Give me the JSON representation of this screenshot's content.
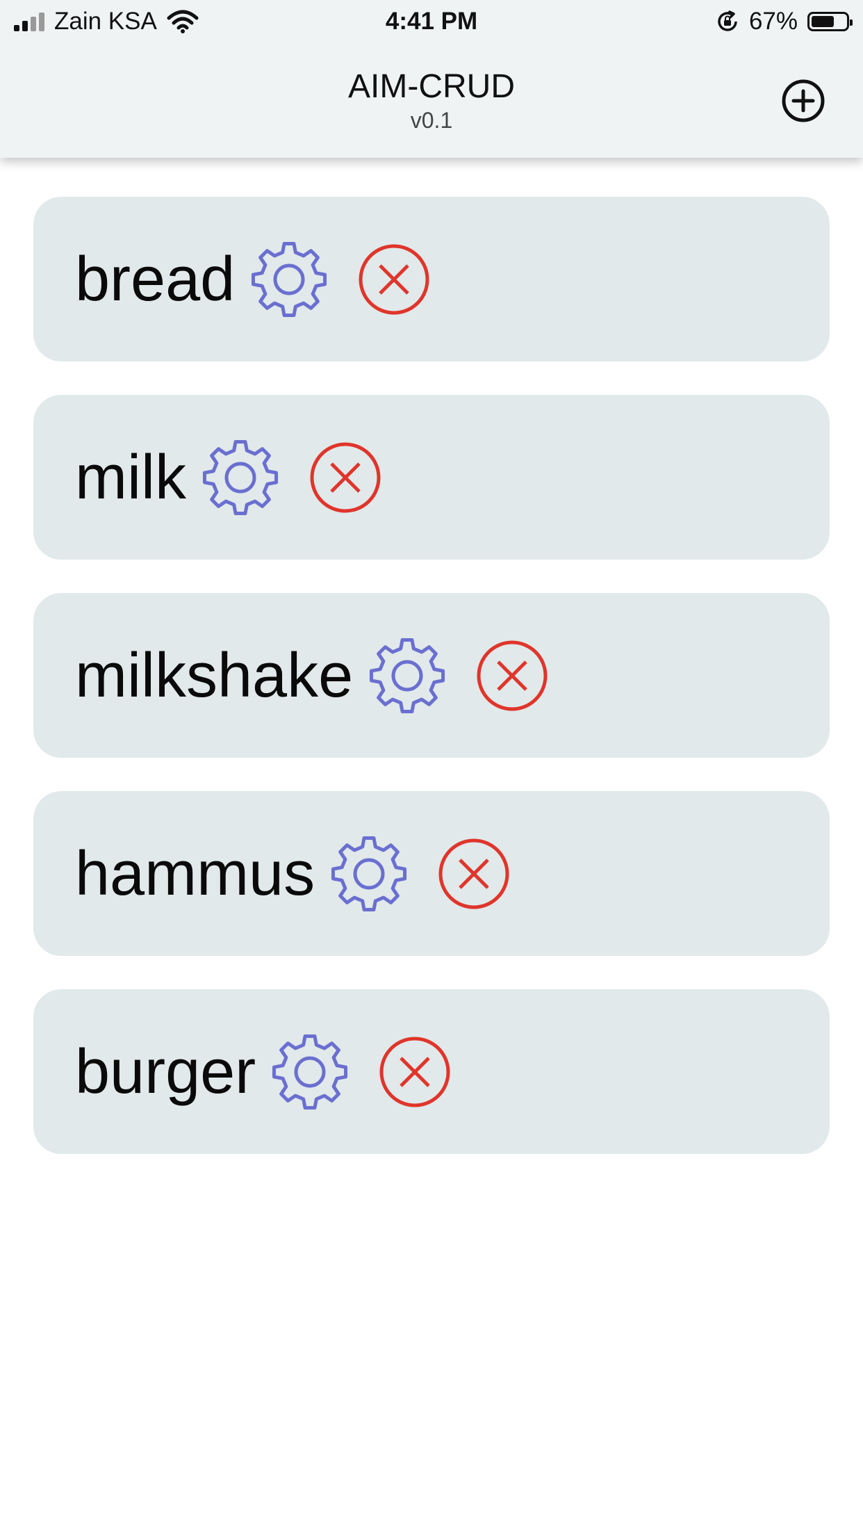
{
  "status_bar": {
    "carrier": "Zain KSA",
    "time": "4:41 PM",
    "battery_percent": "67%",
    "battery_level": 0.67,
    "icons": [
      "signal-icon",
      "wifi-icon",
      "rotation-lock-icon",
      "battery-icon"
    ]
  },
  "header": {
    "title": "AIM-CRUD",
    "version": "v0.1",
    "add_icon": "plus-circle-icon"
  },
  "items": [
    {
      "name": "bread"
    },
    {
      "name": "milk"
    },
    {
      "name": "milkshake"
    },
    {
      "name": "hammus"
    },
    {
      "name": "burger"
    }
  ],
  "colors": {
    "header_bg": "#eff3f4",
    "card_bg": "#e1e9ea",
    "gear": "#6a6fd0",
    "delete": "#e0352b"
  }
}
